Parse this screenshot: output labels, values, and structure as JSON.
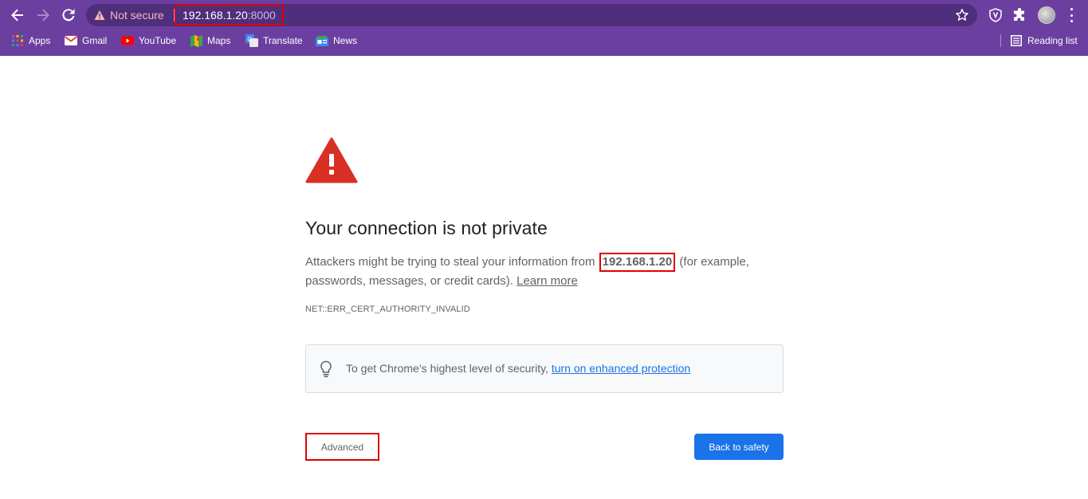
{
  "browser": {
    "security_chip_label": "Not secure",
    "url_host": "192.168.1.20",
    "url_port": ":8000",
    "bookmarks": [
      {
        "label": "Apps",
        "icon": "apps-grid-icon"
      },
      {
        "label": "Gmail",
        "icon": "gmail-icon"
      },
      {
        "label": "YouTube",
        "icon": "youtube-icon"
      },
      {
        "label": "Maps",
        "icon": "maps-icon"
      },
      {
        "label": "Translate",
        "icon": "translate-icon"
      },
      {
        "label": "News",
        "icon": "news-icon"
      }
    ],
    "reading_list_label": "Reading list",
    "colors": {
      "chrome_bg": "#6b3fa0",
      "omnibox_bg": "#4f2e7b",
      "highlight_border": "#e00000"
    }
  },
  "interstitial": {
    "heading": "Your connection is not private",
    "explanation_before": "Attackers might be trying to steal your information from ",
    "host": "192.168.1.20",
    "explanation_after": " (for example, passwords, messages, or credit cards). ",
    "learn_more": "Learn more",
    "error_code": "NET::ERR_CERT_AUTHORITY_INVALID",
    "tip_text": "To get Chrome’s highest level of security, ",
    "tip_link": "turn on enhanced protection",
    "advanced_button": "Advanced",
    "back_button": "Back to safety",
    "colors": {
      "warning_red": "#d93025",
      "primary_blue": "#1a73e8"
    }
  }
}
